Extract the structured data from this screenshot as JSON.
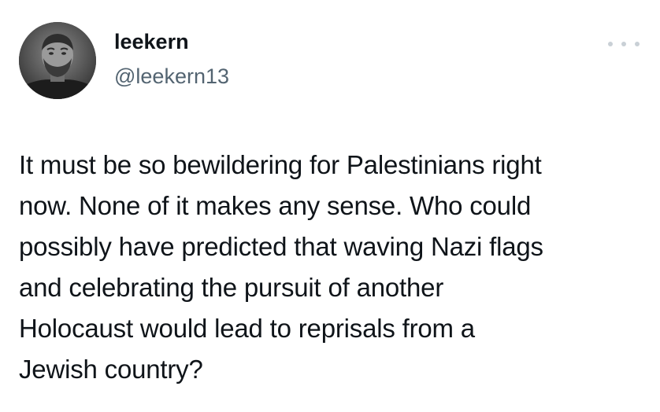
{
  "user": {
    "display_name": "leekern",
    "handle": "@leekern13",
    "avatar_icon": "profile-photo"
  },
  "menu": {
    "icon": "more-icon"
  },
  "tweet": {
    "text": "It must be so bewildering for Palestinians right\nnow. None of it makes any sense. Who could\npossibly have predicted that waving Nazi flags\nand celebrating the pursuit of another\nHolocaust would lead to reprisals from a\nJewish country?"
  },
  "colors": {
    "text": "#0f1419",
    "secondary": "#536471",
    "menu_dots": "#c9d0d6"
  }
}
